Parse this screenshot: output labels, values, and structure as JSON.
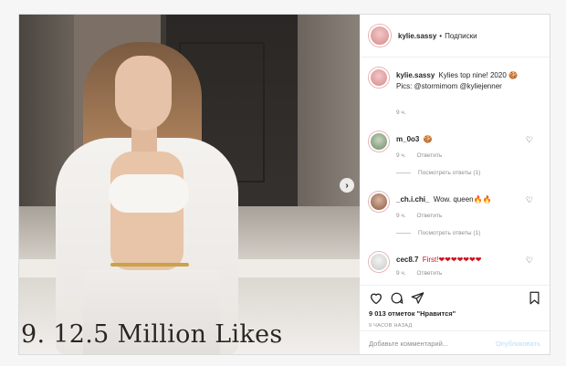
{
  "media": {
    "caption": "9. 12.5 Million Likes"
  },
  "header": {
    "username": "kylie.sassy",
    "dot": "•",
    "follow_label": "Подписки"
  },
  "post": {
    "username": "kylie.sassy",
    "text_line1": "Kylies top nine! 2020 🍪",
    "text_line2": "Pics: @stormimom @kyliejenner",
    "time": "9 ч."
  },
  "comments": [
    {
      "username": "m_0o3",
      "text": "🍪",
      "time": "9 ч.",
      "reply_label": "Ответить",
      "view_replies": "Посмотреть ответы (1)"
    },
    {
      "username": "_ch.i.chi_",
      "text": "Wow. queen🔥🔥",
      "time": "9 ч.",
      "reply_label": "Ответить",
      "view_replies": "Посмотреть ответы (1)"
    },
    {
      "username": "cec8.7",
      "text": "First!❤❤❤❤❤❤❤",
      "time": "9 ч.",
      "reply_label": "Ответить"
    }
  ],
  "likes": {
    "count": "9 013",
    "label": "отметок \"Нравится\""
  },
  "timestamp": "9 ЧАСОВ НАЗАД",
  "comment_box": {
    "placeholder": "Добавьте комментарий...",
    "publish_label": "Опубликовать"
  }
}
